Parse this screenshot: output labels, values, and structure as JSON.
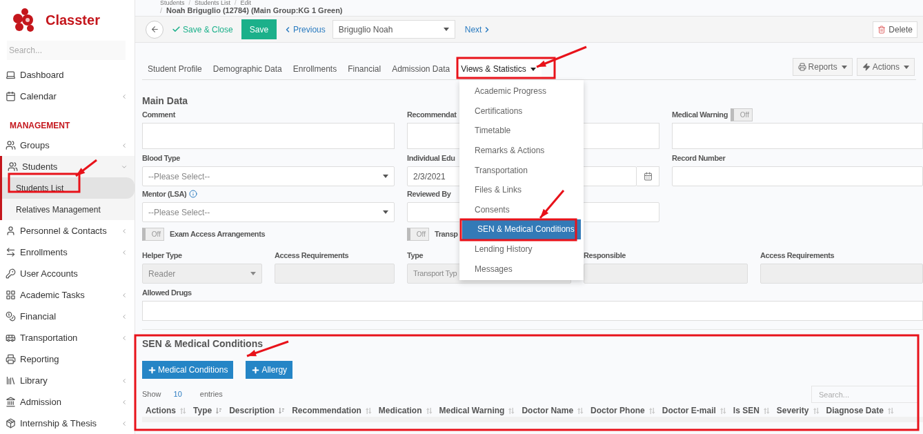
{
  "sidebar": {
    "brand": "Classter",
    "search_placeholder": "Search...",
    "items": [
      {
        "kind": "item",
        "label": "Dashboard",
        "expandable": false
      },
      {
        "kind": "item",
        "label": "Calendar",
        "expandable": true
      },
      {
        "kind": "heading",
        "label": "MANAGEMENT"
      },
      {
        "kind": "item",
        "label": "Groups",
        "expandable": true
      },
      {
        "kind": "item",
        "label": "Students",
        "expandable": true,
        "expanded": true,
        "children": [
          {
            "label": "Students List",
            "selected": true
          },
          {
            "label": "Relatives Management",
            "selected": false
          }
        ]
      },
      {
        "kind": "item",
        "label": "Personnel & Contacts",
        "expandable": true
      },
      {
        "kind": "item",
        "label": "Enrollments",
        "expandable": true
      },
      {
        "kind": "item",
        "label": "User Accounts",
        "expandable": false
      },
      {
        "kind": "item",
        "label": "Academic Tasks",
        "expandable": true
      },
      {
        "kind": "item",
        "label": "Financial",
        "expandable": true
      },
      {
        "kind": "item",
        "label": "Transportation",
        "expandable": true
      },
      {
        "kind": "item",
        "label": "Reporting",
        "expandable": false
      },
      {
        "kind": "item",
        "label": "Library",
        "expandable": true
      },
      {
        "kind": "item",
        "label": "Admission",
        "expandable": true
      },
      {
        "kind": "item",
        "label": "Internship & Thesis",
        "expandable": true
      }
    ]
  },
  "breadcrumb": [
    "Students",
    "Students List",
    "Edit"
  ],
  "breadcrumb_separator": "/",
  "page_title": "Noah Briguglio (12784) (Main Group:KG 1 Green)",
  "toolbar": {
    "save_close": "Save & Close",
    "save": "Save",
    "previous": "Previous",
    "student_select": "Briguglio Noah",
    "next": "Next",
    "delete": "Delete"
  },
  "tabs": [
    {
      "label": "Student Profile",
      "selected": false,
      "dropdown": false
    },
    {
      "label": "Demographic Data",
      "selected": false,
      "dropdown": false
    },
    {
      "label": "Enrollments",
      "selected": false,
      "dropdown": false
    },
    {
      "label": "Financial",
      "selected": false,
      "dropdown": false
    },
    {
      "label": "Admission Data",
      "selected": false,
      "dropdown": false
    },
    {
      "label": "Views & Statistics",
      "selected": true,
      "dropdown": true
    }
  ],
  "tab_actions": [
    "Reports",
    "Actions"
  ],
  "views_menu": [
    {
      "label": "Academic Progress",
      "selected": false
    },
    {
      "label": "Certifications",
      "selected": false
    },
    {
      "label": "Timetable",
      "selected": false
    },
    {
      "label": "Remarks & Actions",
      "selected": false
    },
    {
      "label": "Transportation",
      "selected": false
    },
    {
      "label": "Files & Links",
      "selected": false
    },
    {
      "label": "Consents",
      "selected": false
    },
    {
      "label": "SEN & Medical Conditions",
      "selected": true
    },
    {
      "label": "Lending History",
      "selected": false
    },
    {
      "label": "Messages",
      "selected": false
    }
  ],
  "main_data": {
    "title": "Main Data",
    "row_1": [
      {
        "label": "Comment"
      },
      {
        "label": "Recommendat"
      },
      {
        "label": "Medical Warning",
        "toggle": {
          "on": false,
          "text": "Off"
        }
      }
    ],
    "row_2": [
      {
        "kind": "select",
        "label": "Blood Type",
        "placeholder": "--Please Select--"
      },
      {
        "kind": "date",
        "label": "Individual Edu",
        "value": "2/3/2021"
      },
      {
        "kind": "input",
        "label": "Record Number"
      }
    ],
    "row_3": [
      {
        "kind": "select",
        "label": "Mentor (LSA)",
        "info": true,
        "placeholder": "--Please Select--"
      },
      {
        "kind": "input",
        "label": "Reviewed By"
      }
    ],
    "toggles": [
      {
        "label": "Exam Access Arrangements",
        "on": false,
        "text": "Off"
      },
      {
        "label": "Transp",
        "on": false,
        "text": "Off"
      }
    ],
    "row_5": [
      {
        "kind": "select",
        "label": "Helper Type",
        "value": "Reader",
        "disabled": true
      },
      {
        "kind": "input",
        "label": "Access Requirements",
        "disabled": true
      },
      {
        "kind": "input",
        "label": "Type",
        "placeholder": "Transport Typ",
        "disabled": true
      },
      {
        "kind": "input",
        "label": "Responsible",
        "disabled": true
      },
      {
        "kind": "input",
        "label": "Access Requirements",
        "disabled": true
      }
    ],
    "allowed_drugs": {
      "label": "Allowed Drugs"
    }
  },
  "sen": {
    "title": "SEN & Medical Conditions",
    "buttons": [
      "Medical Conditions",
      "Allergy"
    ],
    "show": "Show",
    "page_size": "10",
    "entries": "entries",
    "search_placeholder": "Search...",
    "columns": [
      {
        "label": "Actions",
        "sorted": false
      },
      {
        "label": "Type",
        "sorted": true
      },
      {
        "label": "Description",
        "sorted": true
      },
      {
        "label": "Recommendation",
        "sorted": false
      },
      {
        "label": "Medication",
        "sorted": false
      },
      {
        "label": "Medical Warning",
        "sorted": false
      },
      {
        "label": "Doctor Name",
        "sorted": false
      },
      {
        "label": "Doctor Phone",
        "sorted": false
      },
      {
        "label": "Doctor E-mail",
        "sorted": false
      },
      {
        "label": "Is SEN",
        "sorted": false
      },
      {
        "label": "Severity",
        "sorted": false
      },
      {
        "label": "Diagnose Date",
        "sorted": false
      }
    ]
  }
}
